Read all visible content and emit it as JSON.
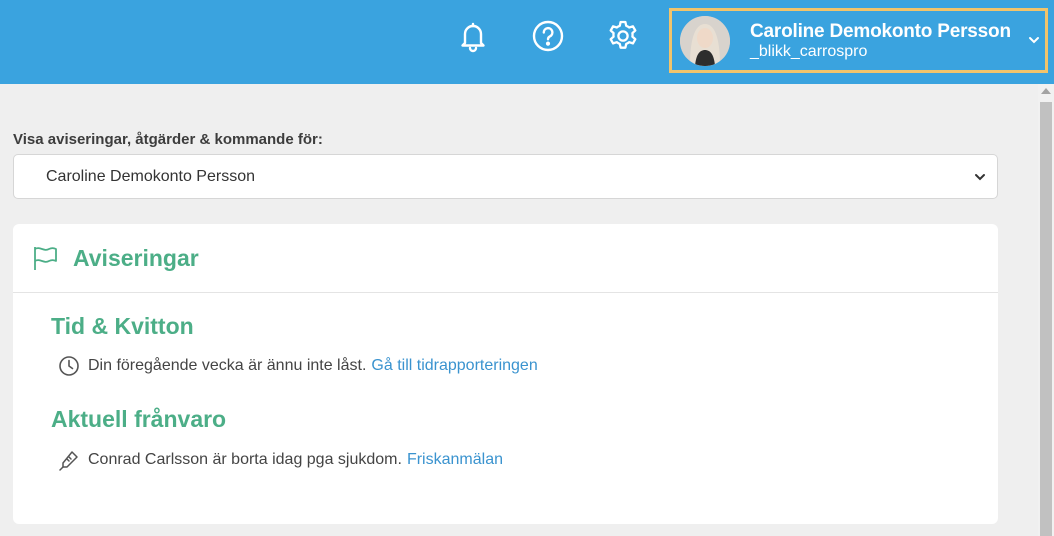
{
  "header": {
    "icons": [
      "bell-icon",
      "help-icon",
      "gear-icon"
    ],
    "user": {
      "name": "Caroline Demokonto Persson",
      "handle": "_blikk_carrospro"
    },
    "colors": {
      "bar": "#3aa3df",
      "highlight": "#f2c46b"
    }
  },
  "filter": {
    "label": "Visa aviseringar, åtgärder & kommande för:",
    "selected": "Caroline Demokonto Persson"
  },
  "notifications": {
    "title": "Aviseringar",
    "sections": [
      {
        "title": "Tid & Kvitton",
        "icon": "clock-icon",
        "text": "Din föregående vecka är ännu inte låst.",
        "link": "Gå till tidrapporteringen"
      },
      {
        "title": "Aktuell frånvaro",
        "icon": "thermometer-icon",
        "text": "Conrad Carlsson är borta idag pga sjukdom.",
        "link": "Friskanmälan"
      }
    ],
    "colors": {
      "accent": "#4cae87",
      "link": "#3a93cf"
    }
  }
}
